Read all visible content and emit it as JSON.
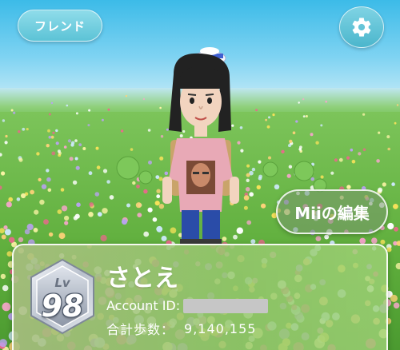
{
  "header": {
    "friend_label": "フレンド",
    "settings_icon": "gear-icon"
  },
  "mii_edit": {
    "label": "Miiの編集"
  },
  "profile": {
    "level_prefix": "Lv",
    "level": "98",
    "name": "さとえ",
    "account_id_label": "Account ID:",
    "total_steps_label": "合計歩数：",
    "total_steps_value": "9,140,155"
  },
  "colors": {
    "sky_top": "#3cbbe8",
    "meadow": "#5fae3c",
    "button_teal": "#5cc3d6",
    "card_green": "#a2c878"
  }
}
